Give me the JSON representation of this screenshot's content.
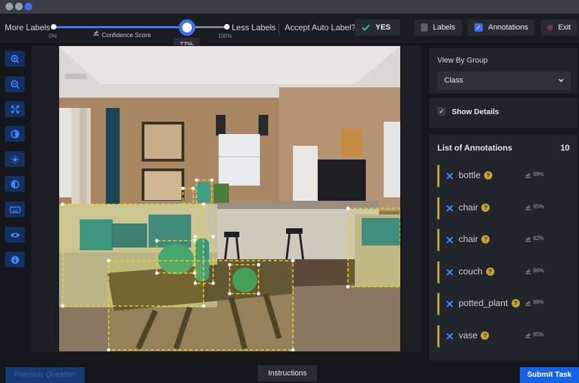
{
  "toolbar": {
    "more_labels": "More Labels",
    "less_labels": "Less Labels",
    "min_pct": "0%",
    "max_pct": "100%",
    "slider_caption": "Confidence Score",
    "confidence_value": 0.77,
    "tooltip": "77%",
    "accept_question": "Accept Auto Label?",
    "yes_label": "YES",
    "labels_toggle": "Labels",
    "annotations_toggle": "Annotations",
    "exit_label": "Exit"
  },
  "tools": [
    "zoom-in-icon",
    "zoom-out-icon",
    "fit-screen-icon",
    "brightness-icon",
    "sun-icon",
    "contrast-icon",
    "keyboard-icon",
    "eye-icon",
    "info-icon"
  ],
  "right_panel": {
    "view_by_group_title": "View By Group",
    "group_value": "Class",
    "show_details_label": "Show Details",
    "list_title": "List of Annotations",
    "list_count": "10",
    "annotations": [
      {
        "label": "bottle",
        "pct": "98%"
      },
      {
        "label": "chair",
        "pct": "95%"
      },
      {
        "label": "chair",
        "pct": "92%"
      },
      {
        "label": "couch",
        "pct": "96%"
      },
      {
        "label": "potted_plant",
        "pct": "98%"
      },
      {
        "label": "vase",
        "pct": "95%"
      }
    ]
  },
  "footer": {
    "previous": "Previous Question",
    "instructions": "Instructions",
    "submit": "Submit Task"
  },
  "colors": {
    "accent": "#3d6ff0",
    "annotation": "#e8d41e",
    "yes_check": "#2fc46a",
    "exit_icon": "#e0455a"
  }
}
